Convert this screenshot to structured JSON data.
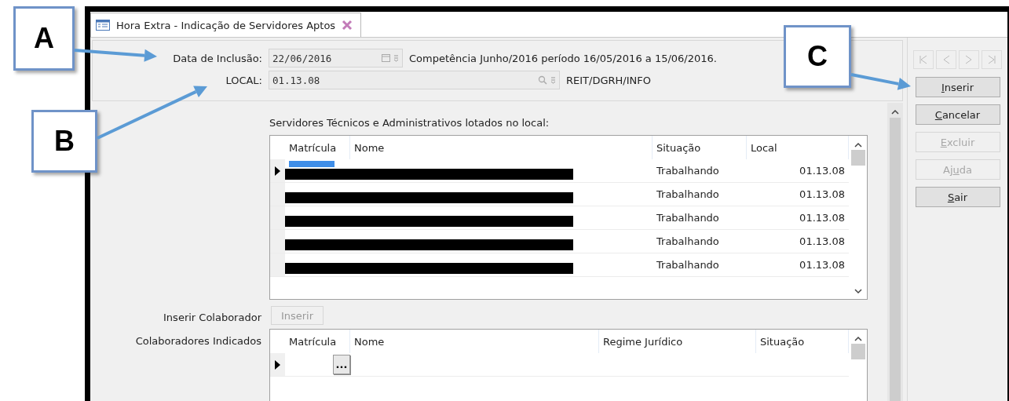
{
  "callouts": [
    {
      "letter": "A"
    },
    {
      "letter": "B"
    },
    {
      "letter": "C"
    }
  ],
  "tab": {
    "title": "Hora Extra - Indicação de Servidores Aptos",
    "selected": true
  },
  "header": {
    "date_label": "Data de Inclusão:",
    "date_value": "22/06/2016",
    "competencia": "Competência Junho/2016 período 16/05/2016 a 15/06/2016.",
    "local_label": "LOCAL:",
    "local_value": "01.13.08",
    "local_name": "REIT/DGRH/INFO"
  },
  "servidores": {
    "title": "Servidores Técnicos e Administrativos lotados no local:",
    "columns": [
      "Matrícula",
      "Nome",
      "Situação",
      "Local"
    ],
    "rows": [
      {
        "selected": true,
        "redacted": true,
        "situacao": "Trabalhando",
        "local": "01.13.08"
      },
      {
        "selected": false,
        "redacted": true,
        "situacao": "Trabalhando",
        "local": "01.13.08"
      },
      {
        "selected": false,
        "redacted": true,
        "situacao": "Trabalhando",
        "local": "01.13.08"
      },
      {
        "selected": false,
        "redacted": true,
        "situacao": "Trabalhando",
        "local": "01.13.08"
      },
      {
        "selected": false,
        "redacted": true,
        "situacao": "Trabalhando",
        "local": "01.13.08"
      }
    ]
  },
  "inserir_colaborador": {
    "label": "Inserir Colaborador",
    "button": {
      "label": "Inserir",
      "disabled": true
    }
  },
  "colaboradores": {
    "label": "Colaboradores Indicados",
    "columns": [
      "Matrícula",
      "Nome",
      "Regime Jurídico",
      "Situação"
    ],
    "rows": [
      {
        "selected": true,
        "lookup": "..."
      }
    ]
  },
  "side_buttons": [
    {
      "key": "I",
      "after": "nserir",
      "disabled": false
    },
    {
      "key": "C",
      "after": "ancelar",
      "disabled": false
    },
    {
      "key": "E",
      "after": "xcluir",
      "disabled": true
    },
    {
      "before": "Aj",
      "key": "u",
      "after": "da",
      "disabled": true
    },
    {
      "key": "S",
      "after": "air",
      "disabled": false
    }
  ]
}
